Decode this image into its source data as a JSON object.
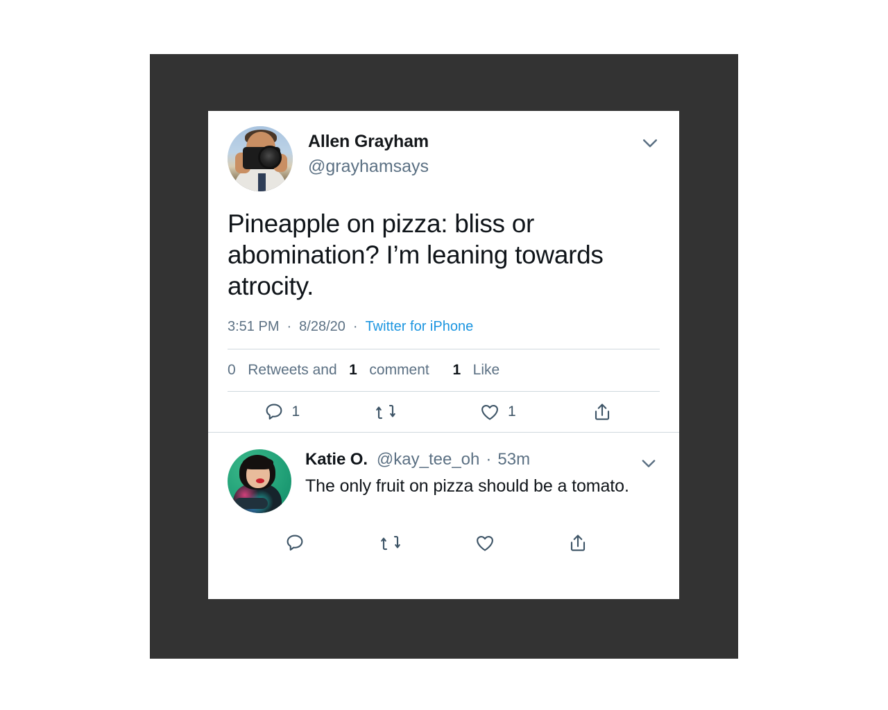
{
  "colors": {
    "backdrop": "#333333",
    "card": "#ffffff",
    "text_primary": "#0f1419",
    "text_secondary": "#5b7083",
    "link": "#1b95e0",
    "icon": "#3d5466",
    "divider": "#cfd9de"
  },
  "tweet": {
    "display_name": "Allen Grayham",
    "handle": "@grayhamsays",
    "avatar_alt": "photographer-holding-camera",
    "text": "Pineapple on pizza: bliss or abomination? I’m leaning towards atrocity.",
    "time": "3:51 PM",
    "separator": "·",
    "date": "8/28/20",
    "source": "Twitter for iPhone",
    "stats": {
      "retweets_count": "0",
      "retweets_label": "Retweets and",
      "comments_count": "1",
      "comments_label": "comment",
      "likes_count": "1",
      "likes_label": "Like"
    },
    "actions": [
      {
        "icon": "reply-icon",
        "count": "1"
      },
      {
        "icon": "retweet-icon",
        "count": ""
      },
      {
        "icon": "like-icon",
        "count": "1"
      },
      {
        "icon": "share-icon",
        "count": ""
      }
    ],
    "menu_icon": "chevron-down-icon"
  },
  "reply": {
    "display_name": "Katie O.",
    "handle": "@kay_tee_oh",
    "dot": "·",
    "timestamp": "53m",
    "avatar_alt": "woman-with-bob-haircut-floral-jacket",
    "text": "The only fruit on pizza should be a tomato.",
    "actions": [
      {
        "icon": "reply-icon",
        "count": ""
      },
      {
        "icon": "retweet-icon",
        "count": ""
      },
      {
        "icon": "like-icon",
        "count": ""
      },
      {
        "icon": "share-icon",
        "count": ""
      }
    ],
    "menu_icon": "chevron-down-icon"
  }
}
